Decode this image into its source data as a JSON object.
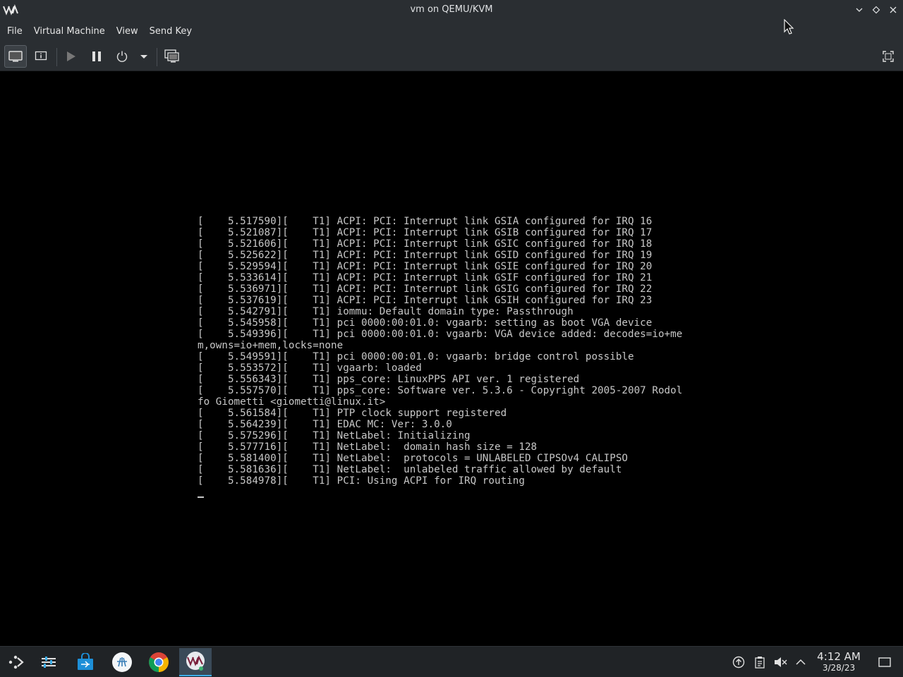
{
  "window": {
    "title": "vm on QEMU/KVM",
    "icons": [
      "virt-manager-logo",
      "minimize-icon",
      "maximize-icon",
      "close-icon"
    ]
  },
  "menubar": {
    "items": [
      {
        "label": "File"
      },
      {
        "label": "Virtual Machine"
      },
      {
        "label": "View"
      },
      {
        "label": "Send Key"
      }
    ]
  },
  "toolbar": {
    "buttons": [
      "console-view",
      "details-view",
      "run",
      "pause",
      "shutdown",
      "shutdown-menu",
      "snapshots",
      "fullscreen"
    ]
  },
  "console": {
    "lines": [
      "[    5.517590][    T1] ACPI: PCI: Interrupt link GSIA configured for IRQ 16",
      "[    5.521087][    T1] ACPI: PCI: Interrupt link GSIB configured for IRQ 17",
      "[    5.521606][    T1] ACPI: PCI: Interrupt link GSIC configured for IRQ 18",
      "[    5.525622][    T1] ACPI: PCI: Interrupt link GSID configured for IRQ 19",
      "[    5.529594][    T1] ACPI: PCI: Interrupt link GSIE configured for IRQ 20",
      "[    5.533614][    T1] ACPI: PCI: Interrupt link GSIF configured for IRQ 21",
      "[    5.536971][    T1] ACPI: PCI: Interrupt link GSIG configured for IRQ 22",
      "[    5.537619][    T1] ACPI: PCI: Interrupt link GSIH configured for IRQ 23",
      "[    5.542791][    T1] iommu: Default domain type: Passthrough",
      "[    5.545958][    T1] pci 0000:00:01.0: vgaarb: setting as boot VGA device",
      "[    5.549396][    T1] pci 0000:00:01.0: vgaarb: VGA device added: decodes=io+me",
      "m,owns=io+mem,locks=none",
      "[    5.549591][    T1] pci 0000:00:01.0: vgaarb: bridge control possible",
      "[    5.553572][    T1] vgaarb: loaded",
      "[    5.556343][    T1] pps_core: LinuxPPS API ver. 1 registered",
      "[    5.557570][    T1] pps_core: Software ver. 5.3.6 - Copyright 2005-2007 Rodol",
      "fo Giometti <giometti@linux.it>",
      "[    5.561584][    T1] PTP clock support registered",
      "[    5.564239][    T1] EDAC MC: Ver: 3.0.0",
      "[    5.575296][    T1] NetLabel: Initializing",
      "[    5.577716][    T1] NetLabel:  domain hash size = 128",
      "[    5.581400][    T1] NetLabel:  protocols = UNLABELED CIPSOv4 CALIPSO",
      "[    5.581636][    T1] NetLabel:  unlabeled traffic allowed by default",
      "[    5.584978][    T1] PCI: Using ACPI for IRQ routing"
    ]
  },
  "taskbar": {
    "apps": [
      "application-launcher-icon",
      "task-manager-icon",
      "discover-store-icon",
      "app-icon",
      "chrome-icon",
      "virt-manager-icon"
    ],
    "tray": [
      "update-icon",
      "clipboard-icon",
      "volume-muted-icon",
      "tray-expand-icon"
    ],
    "clock": {
      "time": "4:12 AM",
      "date": "3/28/23"
    }
  },
  "colors": {
    "chrome_bg": "#2a2e32",
    "taskbar_bg": "#202326",
    "accent": "#3daee9",
    "console_text": "#c8c8c8"
  }
}
